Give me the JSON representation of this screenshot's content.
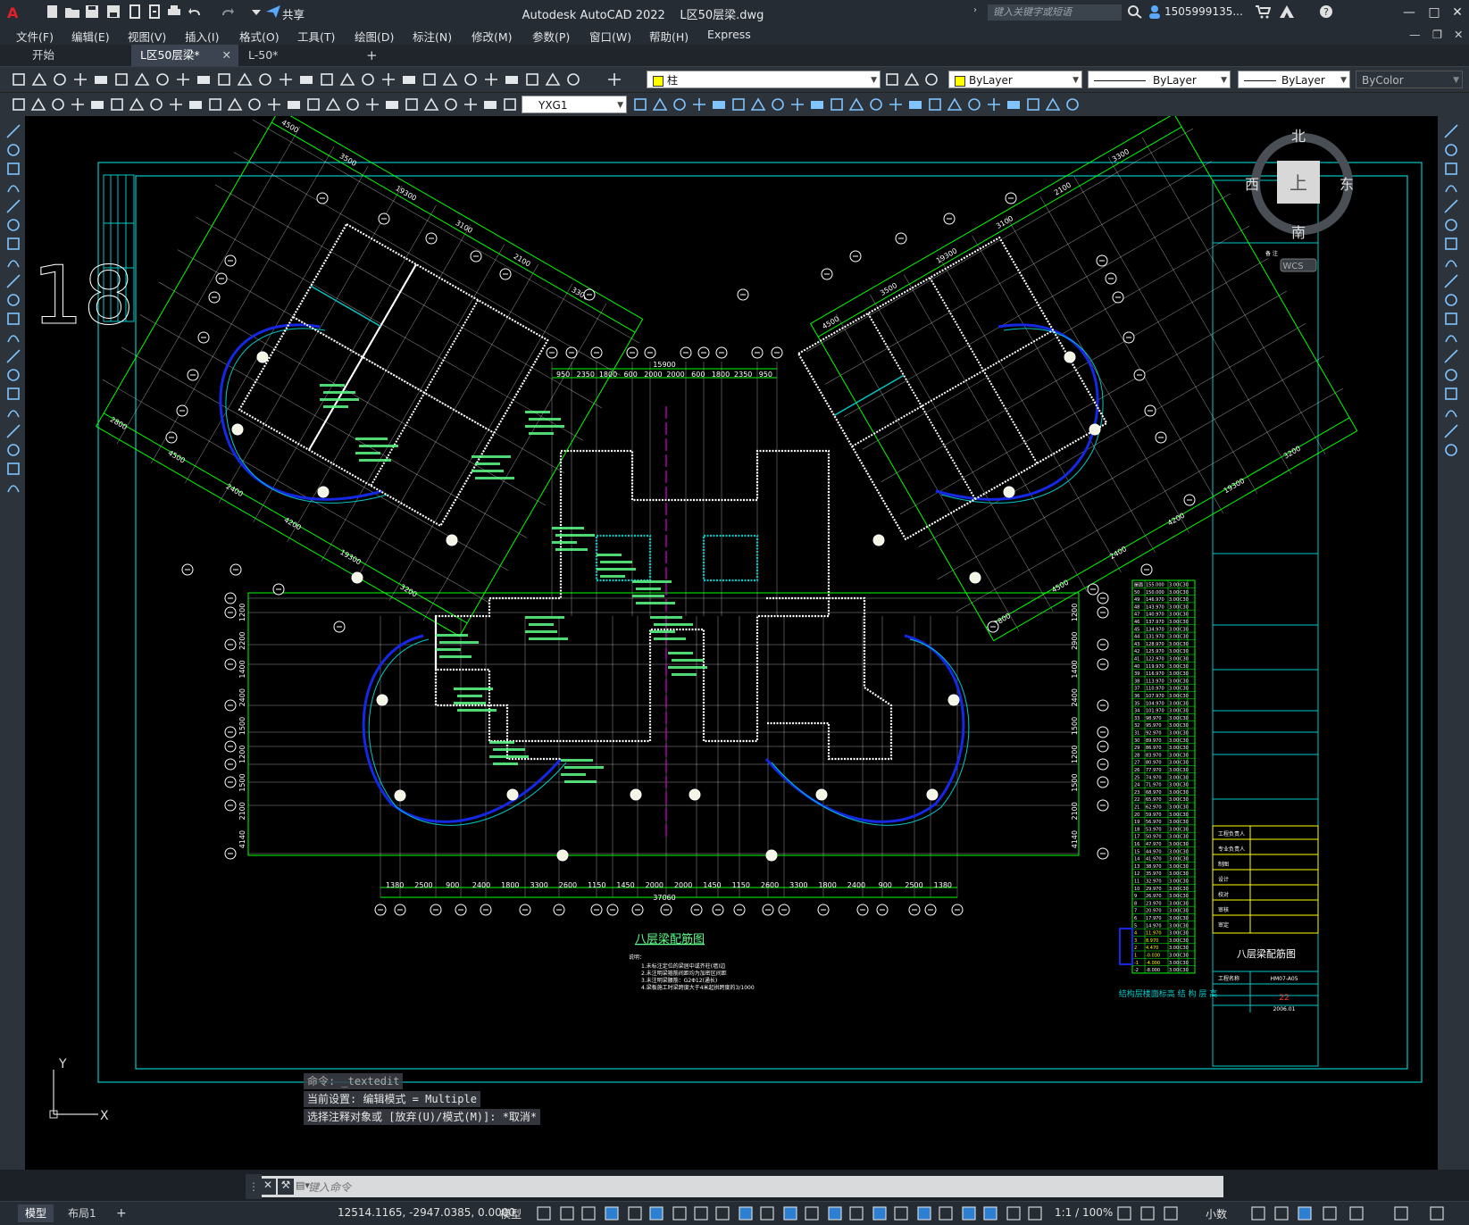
{
  "titlebar": {
    "app_title": "Autodesk AutoCAD 2022",
    "doc_title": "L区50层梁.dwg",
    "share_label": "共享",
    "search_placeholder": "键入关键字或短语",
    "user": "1505999135...",
    "logo": "A"
  },
  "menu": [
    "文件(F)",
    "编辑(E)",
    "视图(V)",
    "插入(I)",
    "格式(O)",
    "工具(T)",
    "绘图(D)",
    "标注(N)",
    "修改(M)",
    "参数(P)",
    "窗口(W)",
    "帮助(H)",
    "Express"
  ],
  "tabs": [
    {
      "label": "开始",
      "active": false
    },
    {
      "label": "L区50层梁*",
      "active": true
    },
    {
      "label": "L-50*",
      "active": false
    }
  ],
  "tab_add": "+",
  "toolbar": {
    "layer_value": "柱",
    "color_value": "ByLayer",
    "linetype_value": "ByLayer",
    "lineweight_value": "ByLayer",
    "plotstyle_value": "ByColor",
    "dimstyle_value": "YXG1"
  },
  "viewcube": {
    "north": "北",
    "south": "南",
    "east": "东",
    "west": "西",
    "top": "上",
    "wcs": "WCS"
  },
  "ucs": {
    "x": "X",
    "y": "Y"
  },
  "drawing": {
    "plan_title": "八层梁配筋图",
    "notes_heading": "说明：",
    "notes": [
      "1.未标注定位的梁居中或齐柱(墙)边",
      "2.未注明梁箍筋间距均为加密区间距",
      "3.未注明梁腰筋：G2Φ12(通长)",
      "4.梁板施工时梁跨度大于4米起拱跨度的3/1000"
    ],
    "dims_top": [
      "950",
      "2350",
      "1800",
      "600",
      "2000",
      "2000",
      "600",
      "1800",
      "2350",
      "950"
    ],
    "dim_top_total": "15900",
    "dims_bottom": [
      "1380",
      "2500",
      "900",
      "2400",
      "1800",
      "3300",
      "2600",
      "1150",
      "1450",
      "2000",
      "2000",
      "1450",
      "1150",
      "2600",
      "3300",
      "1800",
      "2400",
      "900",
      "2500",
      "1380"
    ],
    "dim_bottom_total": "37060",
    "dims_left": [
      "1200",
      "2200",
      "1400",
      "2400",
      "1500",
      "1200",
      "1500",
      "2100",
      "4140"
    ],
    "dims_right": [
      "1200",
      "2900",
      "1400",
      "2400",
      "1500",
      "1200",
      "1500",
      "2100",
      "4140"
    ],
    "dims_wing_left": [
      "4500",
      "3500",
      "19300",
      "3100",
      "2100",
      "3300",
      "2800",
      "4500",
      "2400",
      "4200",
      "19300",
      "3200"
    ],
    "dims_wing_right": [
      "4500",
      "3500",
      "19300",
      "3100",
      "2100",
      "3300",
      "2800",
      "4500",
      "2400",
      "4200",
      "19300",
      "3200"
    ],
    "title_block": {
      "project_label": "工程名称",
      "drawing_name": "八层梁配筋图",
      "drawing_no": "HM07-A05",
      "sheet": "22",
      "date": "2006.01",
      "stamp_label": "备 注",
      "rows": [
        "审定",
        "审核",
        "校对",
        "设计",
        "制图",
        "专业负责人",
        "工程负责人"
      ]
    },
    "floor_table_title": "结构层楼面标高 结 构 层 高",
    "floor_table": [
      [
        "屋面",
        "155.000"
      ],
      [
        "50",
        "150.000"
      ],
      [
        "49",
        "146.970"
      ],
      [
        "48",
        "143.970"
      ],
      [
        "47",
        "140.970"
      ],
      [
        "46",
        "137.970"
      ],
      [
        "45",
        "134.970"
      ],
      [
        "44",
        "131.970"
      ],
      [
        "43",
        "128.970"
      ],
      [
        "42",
        "125.970"
      ],
      [
        "41",
        "122.970"
      ],
      [
        "40",
        "119.970"
      ],
      [
        "39",
        "116.970"
      ],
      [
        "38",
        "113.970"
      ],
      [
        "37",
        "110.970"
      ],
      [
        "36",
        "107.970"
      ],
      [
        "35",
        "104.970"
      ],
      [
        "34",
        "101.970"
      ],
      [
        "33",
        "98.970"
      ],
      [
        "32",
        "95.970"
      ],
      [
        "31",
        "92.970"
      ],
      [
        "30",
        "89.970"
      ],
      [
        "29",
        "86.970"
      ],
      [
        "28",
        "83.970"
      ],
      [
        "27",
        "80.970"
      ],
      [
        "26",
        "77.970"
      ],
      [
        "25",
        "74.970"
      ],
      [
        "24",
        "71.970"
      ],
      [
        "23",
        "68.970"
      ],
      [
        "22",
        "65.970"
      ],
      [
        "21",
        "62.970"
      ],
      [
        "20",
        "59.970"
      ],
      [
        "19",
        "56.970"
      ],
      [
        "18",
        "53.970"
      ],
      [
        "17",
        "50.970"
      ],
      [
        "16",
        "47.970"
      ],
      [
        "15",
        "44.970"
      ],
      [
        "14",
        "41.970"
      ],
      [
        "13",
        "38.970"
      ],
      [
        "12",
        "35.970"
      ],
      [
        "11",
        "32.970"
      ],
      [
        "10",
        "29.970"
      ],
      [
        "9",
        "26.970"
      ],
      [
        "8",
        "23.970"
      ],
      [
        "7",
        "20.970"
      ],
      [
        "6",
        "17.970"
      ],
      [
        "5",
        "14.970"
      ],
      [
        "4",
        "11.970"
      ],
      [
        "3",
        "8.970"
      ],
      [
        "2",
        "4.470"
      ],
      [
        "1",
        "-0.030"
      ],
      [
        "-1",
        "-4.000"
      ],
      [
        "-2",
        "-8.000"
      ]
    ],
    "floor_table_h": "3.00",
    "floor_table_c": "C30",
    "left_title_glyph": "18"
  },
  "command": {
    "history": [
      "命令: _textedit",
      "当前设置: 编辑模式 = Multiple",
      "选择注释对象或 [放弃(U)/模式(M)]: *取消*"
    ],
    "placeholder": "键入命令"
  },
  "status": {
    "tab_model": "模型",
    "tab_layout": "布局1",
    "add": "+",
    "coords": "12514.1165, -2947.0385, 0.0000",
    "mode": "模型",
    "scale": "1:1 / 100%",
    "units": "小数"
  },
  "colors": {
    "green": "#00ff00",
    "cyan": "#00c8c8",
    "white": "#ffffff",
    "blue": "#1428e6",
    "yellow": "#ffff00",
    "magenta": "#ff00ff",
    "lime": "#5cff8a",
    "bg": "#000000"
  }
}
